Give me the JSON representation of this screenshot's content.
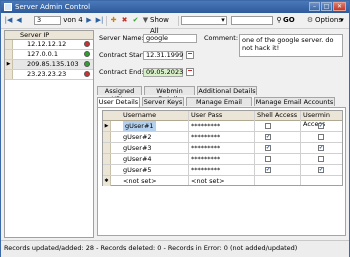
{
  "window": {
    "title": "Server Admin Control",
    "minimize_glyph": "–",
    "maximize_glyph": "□",
    "close_glyph": "✕"
  },
  "toolbar": {
    "record_number": "3",
    "record_of": "von 4",
    "show_all_label": "Show All",
    "go_label": "GO",
    "options_label": "Options",
    "first_glyph": "|◀",
    "prev_glyph": "◀",
    "next_glyph": "▶",
    "last_glyph": "▶|",
    "add_glyph": "✚",
    "delete_glyph": "✖",
    "save_glyph": "✔",
    "filter_glyph": "▼",
    "dropdown_glyph": "▾",
    "search_glyph": "⚲",
    "options_glyph": "⚙",
    "options_arrow": "▾"
  },
  "server_list": {
    "header": "Server IP",
    "selected_marker": "▶",
    "rows": [
      {
        "ip": "12.12.12.12",
        "status_color": "#d03030"
      },
      {
        "ip": "127.0.0.1",
        "status_color": "#30a030"
      },
      {
        "ip": "209.85.135.103",
        "status_color": "#30a030"
      },
      {
        "ip": "23.23.23.23",
        "status_color": "#d03030"
      }
    ]
  },
  "details": {
    "server_name_label": "Server Name:",
    "server_name_value": "google",
    "comment_label": "Comment:",
    "comment_value": "one of the google server. do not hack it!",
    "contract_start_label": "Contract Start:",
    "contract_start_value": "12.31.1999",
    "contract_end_label": "Contract End:",
    "contract_end_value": "09.05.2023",
    "contract_end_bg": "#d8f0c8"
  },
  "tabs_row1": [
    "Assigned URLs",
    "Webmin Details",
    "Additional Details"
  ],
  "tabs_row2": [
    "User Details",
    "Server Keys",
    "Manage Email Server",
    "Manage Email Accounts"
  ],
  "users": {
    "columns": [
      "Username",
      "User Pass",
      "Shell Access",
      "Usermin Access"
    ],
    "check_glyph": "✔",
    "current_marker": "▶",
    "new_marker": "✱",
    "rows": [
      {
        "username": "gUser#1",
        "pass": "*********",
        "shell": false,
        "usermin": true
      },
      {
        "username": "gUser#2",
        "pass": "*********",
        "shell": true,
        "usermin": false
      },
      {
        "username": "gUser#3",
        "pass": "*********",
        "shell": true,
        "usermin": true
      },
      {
        "username": "gUser#4",
        "pass": "*********",
        "shell": false,
        "usermin": false
      },
      {
        "username": "gUser#5",
        "pass": "*********",
        "shell": true,
        "usermin": true
      }
    ],
    "new_row": {
      "username": "<not set>",
      "pass": "<not set>"
    }
  },
  "status": {
    "text": "Records updated/added: 28 - Records deleted: 0 - Records in Error: 0 (not added/updated)"
  }
}
